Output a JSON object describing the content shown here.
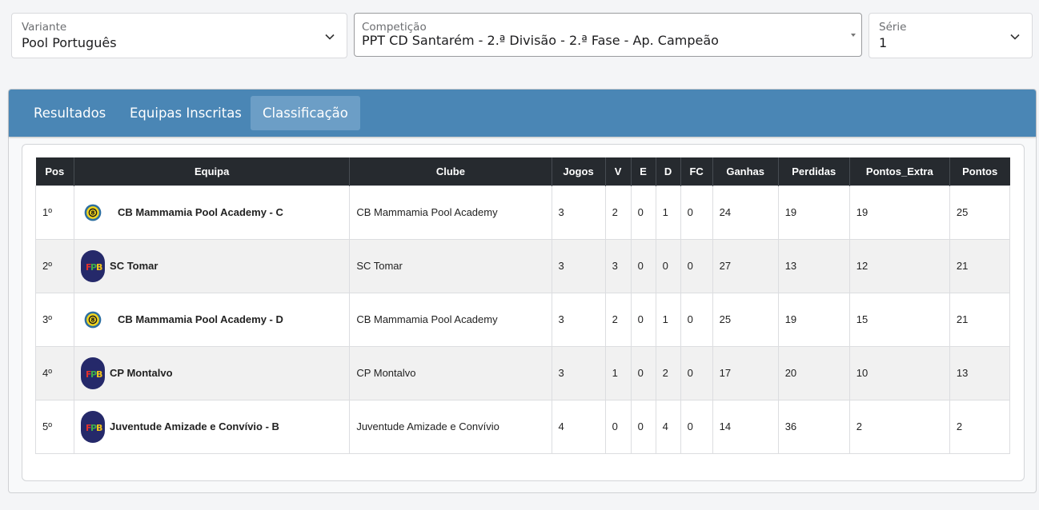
{
  "filters": {
    "variante": {
      "label": "Variante",
      "value": "Pool Português"
    },
    "competicao": {
      "label": "Competição",
      "value": "PPT CD Santarém - 2.ª Divisão - 2.ª Fase - Ap. Campeão"
    },
    "serie": {
      "label": "Série",
      "value": "1"
    }
  },
  "tabs": [
    {
      "label": "Resultados",
      "active": false
    },
    {
      "label": "Equipas Inscritas",
      "active": false
    },
    {
      "label": "Classificação",
      "active": true
    }
  ],
  "table": {
    "headers": [
      "Pos",
      "Equipa",
      "Clube",
      "Jogos",
      "V",
      "E",
      "D",
      "FC",
      "Ganhas",
      "Perdidas",
      "Pontos_Extra",
      "Pontos"
    ],
    "rows": [
      {
        "pos": "1º",
        "equipa": "CB Mammamia Pool Academy - C",
        "logo": "mammamia-logo",
        "clube": "CB Mammamia Pool Academy",
        "jogos": "3",
        "v": "2",
        "e": "0",
        "d": "1",
        "fc": "0",
        "ganhas": "24",
        "perdidas": "19",
        "pontos_extra": "19",
        "pontos": "25"
      },
      {
        "pos": "2º",
        "equipa": "SC Tomar",
        "logo": "fpb-logo",
        "clube": "SC Tomar",
        "jogos": "3",
        "v": "3",
        "e": "0",
        "d": "0",
        "fc": "0",
        "ganhas": "27",
        "perdidas": "13",
        "pontos_extra": "12",
        "pontos": "21"
      },
      {
        "pos": "3º",
        "equipa": "CB Mammamia Pool Academy - D",
        "logo": "mammamia-logo",
        "clube": "CB Mammamia Pool Academy",
        "jogos": "3",
        "v": "2",
        "e": "0",
        "d": "1",
        "fc": "0",
        "ganhas": "25",
        "perdidas": "19",
        "pontos_extra": "15",
        "pontos": "21"
      },
      {
        "pos": "4º",
        "equipa": "CP Montalvo",
        "logo": "fpb-logo",
        "clube": "CP Montalvo",
        "jogos": "3",
        "v": "1",
        "e": "0",
        "d": "2",
        "fc": "0",
        "ganhas": "17",
        "perdidas": "20",
        "pontos_extra": "10",
        "pontos": "13"
      },
      {
        "pos": "5º",
        "equipa": "Juventude Amizade e Convívio - B",
        "logo": "fpb-logo",
        "clube": "Juventude Amizade e Convívio",
        "jogos": "4",
        "v": "0",
        "e": "0",
        "d": "4",
        "fc": "0",
        "ganhas": "14",
        "perdidas": "36",
        "pontos_extra": "2",
        "pontos": "2"
      }
    ]
  },
  "colors": {
    "tabbar": "#4a86b5",
    "active_tab": "#6c9ec6",
    "table_header": "#262a2f"
  }
}
